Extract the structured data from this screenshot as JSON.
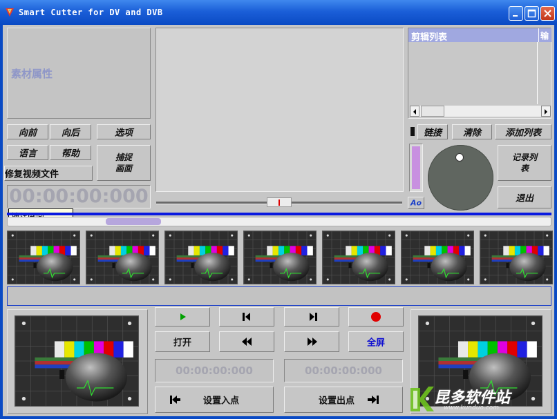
{
  "window": {
    "title": "Smart Cutter for DV and DVB",
    "controls": [
      "minimize",
      "maximize",
      "close"
    ]
  },
  "source_panel": {
    "properties_label": "素材属性"
  },
  "left_buttons": {
    "back": "向前",
    "forward": "向后",
    "options": "选项",
    "language": "语言",
    "help": "帮助",
    "capture_frame": "捕捉画面",
    "repair_video": "修复视频文件"
  },
  "left_timecode": "00:00:00:000",
  "tooltip": "捕捉画面",
  "edit_list": {
    "header": "剪辑列表",
    "header_right": "输"
  },
  "list_buttons": {
    "link": "链接",
    "clear": "清除",
    "add_list": "添加列表"
  },
  "record_list": "记录列表",
  "exit": "退出",
  "ao_label": "Ao",
  "thumbnails_count_label": "",
  "controls": {
    "open": "打开",
    "fullscreen": "全屏",
    "in_timecode": "00:00:00:000",
    "out_timecode": "00:00:00:000",
    "set_in": "设置入点",
    "set_out": "设置出点"
  },
  "watermark": {
    "brand": "昆多软件站",
    "url": "www.kunduo.com"
  },
  "colors": {
    "titlebar": "#1b5fd8",
    "progress_line": "#0a1ae0",
    "play_green": "#00a000",
    "record_red": "#e00000",
    "fullscreen_blue": "#1010d0"
  }
}
